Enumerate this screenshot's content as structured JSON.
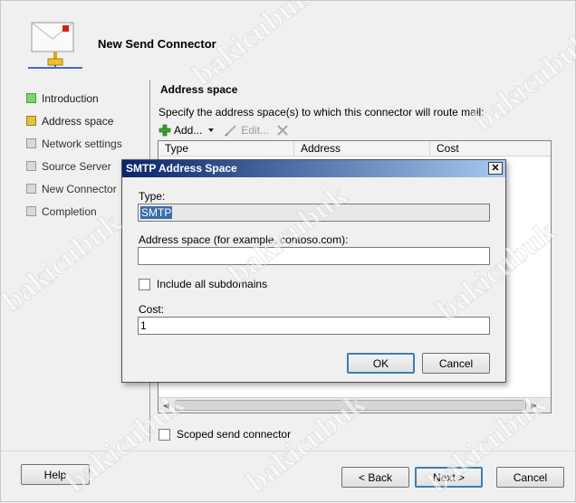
{
  "wizard": {
    "title": "New Send Connector",
    "steps": [
      {
        "label": "Introduction",
        "state": "done"
      },
      {
        "label": "Address space",
        "state": "current"
      },
      {
        "label": "Network settings",
        "state": "pending"
      },
      {
        "label": "Source Server",
        "state": "pending"
      },
      {
        "label": "New Connector",
        "state": "pending"
      },
      {
        "label": "Completion",
        "state": "pending"
      }
    ],
    "section_title": "Address space",
    "section_desc": "Specify the address space(s) to which this connector will route mail:",
    "toolbar": {
      "add_label": "Add...",
      "edit_label": "Edit..."
    },
    "list_columns": [
      "Type",
      "Address",
      "Cost"
    ],
    "scoped_label": "Scoped send connector",
    "buttons": {
      "help": "Help",
      "back": "< Back",
      "next": "Next >",
      "cancel": "Cancel"
    }
  },
  "dialog": {
    "title": "SMTP Address Space",
    "type_label": "Type:",
    "type_value": "SMTP",
    "address_label": "Address space (for example, contoso.com):",
    "address_value": "",
    "subdomains_label": "Include all subdomains",
    "cost_label": "Cost:",
    "cost_value": "1",
    "ok_label": "OK",
    "cancel_label": "Cancel"
  },
  "watermark": "bakicubuk",
  "icons": {
    "wizard_header": "connector-envelope-icon",
    "add": "green-plus-icon",
    "edit": "pencil-icon",
    "remove": "red-x-icon",
    "add_dropdown": "dropdown-arrow-icon"
  },
  "colors": {
    "dialog_title_start": "#0a246a",
    "dialog_title_end": "#a6caf0",
    "step_done": "#7ed36a",
    "step_current": "#e2c23a"
  }
}
